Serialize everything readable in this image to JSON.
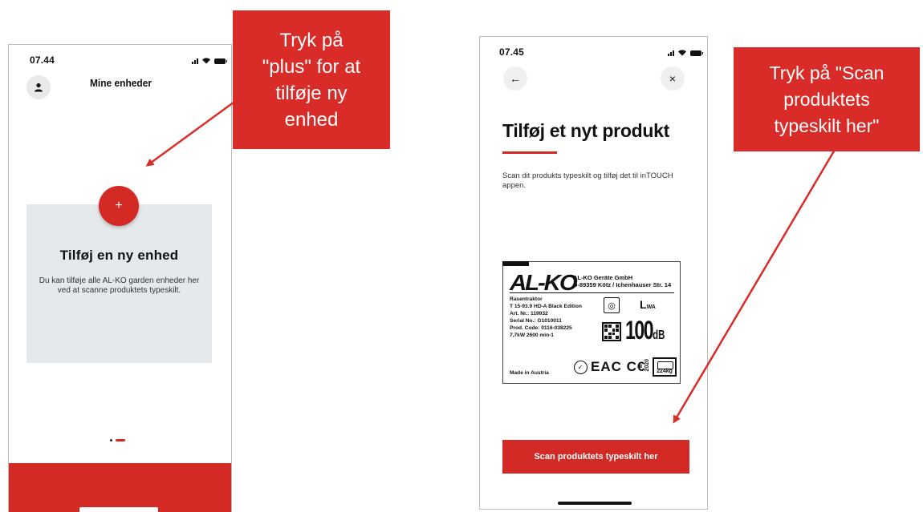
{
  "left_screen": {
    "status_time": "07.44",
    "header_title": "Mine enheder",
    "add_button_glyph": "+",
    "card_title": "Tilføj en ny enhed",
    "card_text": "Du kan tilføje alle AL-KO garden enheder her ved at scanne produktets typeskilt.",
    "icons": [
      "signal-icon",
      "wifi-icon",
      "battery-icon",
      "user-icon",
      "plus-icon"
    ]
  },
  "right_screen": {
    "status_time": "07.45",
    "back_glyph": "←",
    "close_glyph": "×",
    "title": "Tilføj et nyt produkt",
    "description": "Scan dit produkts typeskilt og tilføj det til inTOUCH appen.",
    "scan_button_label": "Scan produktets typeskilt her",
    "accent_color": "#d32a25"
  },
  "typeplate": {
    "logo": "AL-KO",
    "company_line1": "AL-KO Geräte GmbH",
    "company_line2": "D-89359 Kötz / Ichenhauser Str. 14",
    "spec_lines": [
      "Rasentraktor",
      "T 15-93.9 HD-A Black Edition",
      "Art. Nr.:   119932",
      "Serial No.: G1010011",
      "Prod. Code: 0116-038225",
      "7,7kW 2600 min-1"
    ],
    "sound_level": "100",
    "sound_unit": "dB",
    "lwa_label": "L",
    "lwa_sub": "WA",
    "made_in": "Made in Austria",
    "cert_marks": "EAC C€",
    "year": "2020",
    "weight": "224kg"
  },
  "callouts": {
    "left": "Tryk på\n\"plus\" for at\ntilføje ny\nenhed",
    "right": "Tryk på \"Scan\nproduktets\ntypeskilt her\""
  }
}
